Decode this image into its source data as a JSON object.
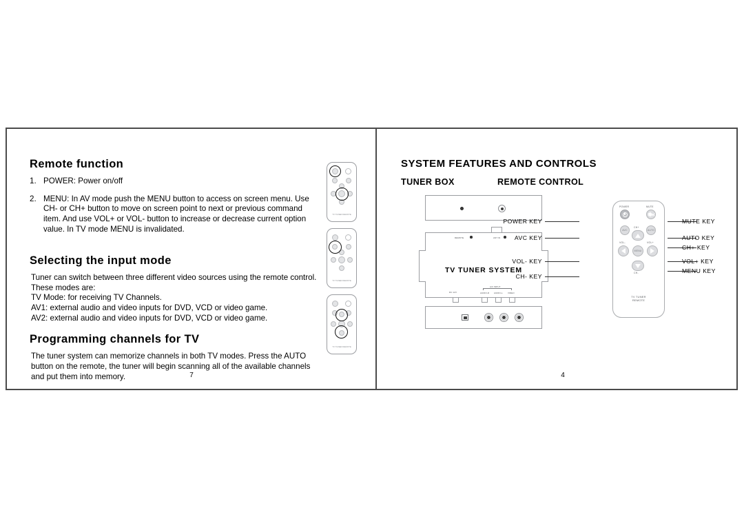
{
  "left_page": {
    "section1": {
      "heading": "Remote function",
      "items": [
        {
          "num": "1.",
          "text": "POWER: Power on/off"
        },
        {
          "num": "2.",
          "text": "MENU: In AV mode push the MENU button to access on screen menu. Use CH- or CH+ button to move on screen point to next or previous command item. And use VOL+ or VOL- button to increase or decrease current option value. In TV mode MENU is invalidated."
        }
      ]
    },
    "section2": {
      "heading": "Selecting the input mode",
      "paragraphs": [
        "Tuner can switch between three different video sources using the remote control. These modes are:",
        "TV Mode: for receiving  TV Channels.",
        "AV1: external audio and video inputs for DVD, VCD or video game.",
        "AV2: external audio and video inputs for DVD, VCD or video game."
      ]
    },
    "section3": {
      "heading": "Programming channels for TV",
      "paragraphs": [
        "The tuner system can memorize channels in both TV modes. Press the AUTO button on the remote, the tuner will begin scanning all of the available channels and put them into memory."
      ]
    },
    "page_number": "7",
    "thumbnails": [
      {
        "name": "remote-thumb-power",
        "footer": "TV TUNER REMOTE"
      },
      {
        "name": "remote-thumb-avc",
        "footer": "TV TUNER REMOTE"
      },
      {
        "name": "remote-thumb-menu",
        "footer": "TV TUNER REMOTE"
      }
    ]
  },
  "right_page": {
    "title": "SYSTEM FEATURES AND CONTROLS",
    "subtitle_tuner": "TUNER BOX",
    "subtitle_remote": "REMOTE CONTROL",
    "page_number": "4",
    "tuner_box": {
      "brand": "TV TUNER SYSTEM",
      "labels": {
        "remote_sensor": "REMOTE",
        "antenna_in": "ANT IN",
        "dc_in": "DC 12V",
        "av_input": "A/V INPUT",
        "audio_r": "AUDIO-R",
        "audio_l": "AUDIO-L",
        "video": "VIDEO"
      }
    },
    "remote": {
      "footer_line1": "TV TUNER",
      "footer_line2": "REMOTE",
      "keys": {
        "power": "POWER",
        "mute": "MUTE",
        "avc": "AVC",
        "auto": "AUTO",
        "ch_up": "CH+",
        "ch_down": "CH-",
        "vol_down": "VOL-",
        "vol_up": "VOL+",
        "menu": "MENU"
      },
      "callouts_left": [
        "POWER KEY",
        "AVC KEY",
        "VOL- KEY",
        "CH- KEY"
      ],
      "callouts_right": [
        "MUTE  KEY",
        "AUTO KEY",
        "CH+  KEY",
        "VOL+  KEY",
        "MENU KEY"
      ]
    }
  }
}
